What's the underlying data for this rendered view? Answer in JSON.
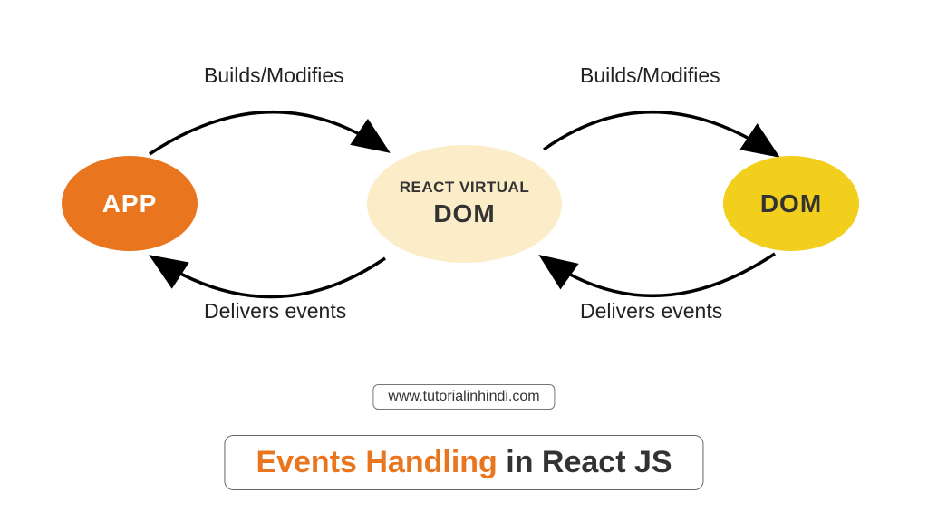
{
  "nodes": {
    "app": "APP",
    "vdom_line1": "REACT VIRTUAL",
    "vdom_line2": "DOM",
    "dom": "DOM"
  },
  "labels": {
    "builds_modifies_1": "Builds/Modifies",
    "builds_modifies_2": "Builds/Modifies",
    "delivers_events_1": "Delivers events",
    "delivers_events_2": "Delivers events"
  },
  "url": "www.tutorialinhindi.com",
  "title": {
    "part1": "Events Handling",
    "part2": " in React JS"
  },
  "colors": {
    "app_bg": "#e9751f",
    "vdom_bg": "#fcedc9",
    "dom_bg": "#f1cf1c",
    "accent": "#e9751f"
  },
  "chart_data": {
    "type": "diagram",
    "nodes": [
      {
        "id": "app",
        "label": "APP",
        "color": "#e9751f"
      },
      {
        "id": "vdom",
        "label": "REACT VIRTUAL DOM",
        "color": "#fcedc9"
      },
      {
        "id": "dom",
        "label": "DOM",
        "color": "#f1cf1c"
      }
    ],
    "edges": [
      {
        "from": "app",
        "to": "vdom",
        "label": "Builds/Modifies"
      },
      {
        "from": "vdom",
        "to": "app",
        "label": "Delivers events"
      },
      {
        "from": "vdom",
        "to": "dom",
        "label": "Builds/Modifies"
      },
      {
        "from": "dom",
        "to": "vdom",
        "label": "Delivers events"
      }
    ],
    "title": "Events Handling in React JS"
  }
}
